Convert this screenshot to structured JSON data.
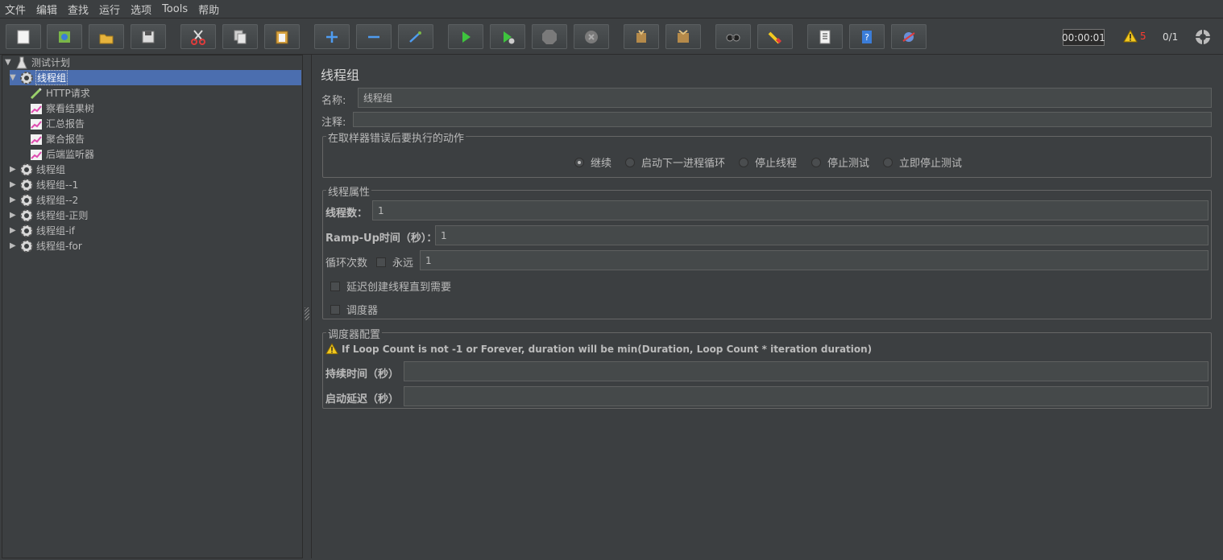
{
  "menu": [
    "文件",
    "编辑",
    "查找",
    "运行",
    "选项",
    "Tools",
    "帮助"
  ],
  "toolbar": {
    "buttons": [
      "new-icon",
      "templates-icon",
      "open-icon",
      "save-icon",
      "cut-icon",
      "copy-icon",
      "paste-icon",
      "expand-icon",
      "collapse-icon",
      "toggle-icon",
      "start-icon",
      "start-no-pause-icon",
      "stop-icon",
      "shutdown-icon",
      "clear-icon",
      "clear-all-icon",
      "search-icon",
      "reset-search-icon",
      "function-helper-icon",
      "help-icon",
      "remote-icon"
    ],
    "timer": "00:00:01",
    "warning_count": "5",
    "threads": "0/1"
  },
  "tree": {
    "root": "测试计划",
    "selected": "线程组",
    "children": [
      "HTTP请求",
      "察看结果树",
      "汇总报告",
      "聚合报告",
      "后端监听器"
    ],
    "siblings": [
      "线程组",
      "线程组--1",
      "线程组--2",
      "线程组-正则",
      "线程组-if",
      "线程组-for"
    ]
  },
  "panel": {
    "title": "线程组",
    "name_label": "名称:",
    "name_value": "线程组",
    "comment_label": "注释:",
    "error_group_title": "在取样器错误后要执行的动作",
    "error_actions": [
      "继续",
      "启动下一进程循环",
      "停止线程",
      "停止测试",
      "立即停止测试"
    ],
    "thread_props_title": "线程属性",
    "threads_label": "线程数：",
    "threads_value": "1",
    "rampup_label": "Ramp-Up时间（秒）：",
    "rampup_value": "1",
    "loop_label": "循环次数",
    "forever_label": "永远",
    "loop_value": "1",
    "delay_create_label": "延迟创建线程直到需要",
    "scheduler_label": "调度器",
    "scheduler_config_title": "调度器配置",
    "scheduler_note": "If Loop Count is not -1 or Forever, duration will be min(Duration, Loop Count * iteration duration)",
    "duration_label": "持续时间（秒）",
    "startup_delay_label": "启动延迟（秒）"
  },
  "colors": {
    "background": "#3c3f41",
    "selection": "#4b6eaf",
    "warning": "#ff3b30"
  }
}
